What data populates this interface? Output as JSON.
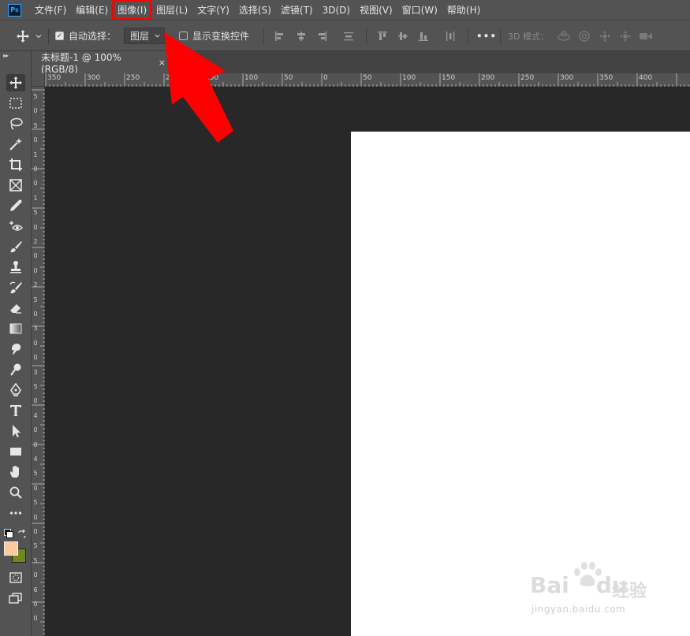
{
  "app": {
    "logo": "Ps"
  },
  "menu": {
    "items": [
      "文件(F)",
      "编辑(E)",
      "图像(I)",
      "图层(L)",
      "文字(Y)",
      "选择(S)",
      "滤镜(T)",
      "3D(D)",
      "视图(V)",
      "窗口(W)",
      "帮助(H)"
    ],
    "highlighted_index": 2,
    "highlight_color": "#ff0000"
  },
  "options": {
    "auto_select_label": "自动选择：",
    "auto_select_checked": true,
    "layer_select_value": "图层",
    "show_transform_label": "显示变换控件",
    "show_transform_checked": false,
    "more_label": "•••",
    "mode_3d_label": "3D 模式："
  },
  "document": {
    "tab_title": "未标题-1 @ 100%(RGB/8)",
    "close_glyph": "×"
  },
  "rulers": {
    "top_labels": [
      "350",
      "300",
      "250",
      "200",
      "150",
      "100",
      "50",
      "0",
      "50",
      "100",
      "150",
      "200",
      "250",
      "300",
      "350",
      "400"
    ],
    "left_labels": [
      "5",
      "0",
      "5",
      "0",
      "1",
      "0",
      "0",
      "1",
      "5",
      "0",
      "2",
      "0",
      "0",
      "2",
      "5",
      "0",
      "3",
      "0",
      "0",
      "3",
      "5",
      "0",
      "4",
      "0",
      "0",
      "4",
      "5",
      "0",
      "5",
      "0",
      "0",
      "5",
      "5",
      "0",
      "6",
      "0",
      "0"
    ]
  },
  "colors": {
    "foreground": "#f9c9a0",
    "background": "#6e8a1f",
    "arrow": "#ff0000",
    "canvas": "#ffffff"
  },
  "watermark": {
    "brand": "Bai",
    "brand_tail": "du",
    "sub": "经验",
    "url": "jingyan.baidu.com"
  }
}
